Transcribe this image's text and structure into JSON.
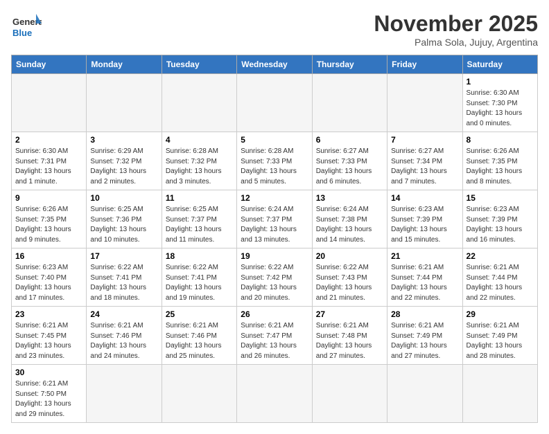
{
  "header": {
    "logo_general": "General",
    "logo_blue": "Blue",
    "month_title": "November 2025",
    "subtitle": "Palma Sola, Jujuy, Argentina"
  },
  "days_of_week": [
    "Sunday",
    "Monday",
    "Tuesday",
    "Wednesday",
    "Thursday",
    "Friday",
    "Saturday"
  ],
  "weeks": [
    [
      {
        "day": "",
        "empty": true
      },
      {
        "day": "",
        "empty": true
      },
      {
        "day": "",
        "empty": true
      },
      {
        "day": "",
        "empty": true
      },
      {
        "day": "",
        "empty": true
      },
      {
        "day": "",
        "empty": true
      },
      {
        "day": "1",
        "sunrise": "6:30 AM",
        "sunset": "7:30 PM",
        "daylight": "13 hours and 0 minutes."
      }
    ],
    [
      {
        "day": "2",
        "sunrise": "6:30 AM",
        "sunset": "7:31 PM",
        "daylight": "13 hours and 1 minute."
      },
      {
        "day": "3",
        "sunrise": "6:29 AM",
        "sunset": "7:32 PM",
        "daylight": "13 hours and 2 minutes."
      },
      {
        "day": "4",
        "sunrise": "6:28 AM",
        "sunset": "7:32 PM",
        "daylight": "13 hours and 3 minutes."
      },
      {
        "day": "5",
        "sunrise": "6:28 AM",
        "sunset": "7:33 PM",
        "daylight": "13 hours and 5 minutes."
      },
      {
        "day": "6",
        "sunrise": "6:27 AM",
        "sunset": "7:33 PM",
        "daylight": "13 hours and 6 minutes."
      },
      {
        "day": "7",
        "sunrise": "6:27 AM",
        "sunset": "7:34 PM",
        "daylight": "13 hours and 7 minutes."
      },
      {
        "day": "8",
        "sunrise": "6:26 AM",
        "sunset": "7:35 PM",
        "daylight": "13 hours and 8 minutes."
      }
    ],
    [
      {
        "day": "9",
        "sunrise": "6:26 AM",
        "sunset": "7:35 PM",
        "daylight": "13 hours and 9 minutes."
      },
      {
        "day": "10",
        "sunrise": "6:25 AM",
        "sunset": "7:36 PM",
        "daylight": "13 hours and 10 minutes."
      },
      {
        "day": "11",
        "sunrise": "6:25 AM",
        "sunset": "7:37 PM",
        "daylight": "13 hours and 11 minutes."
      },
      {
        "day": "12",
        "sunrise": "6:24 AM",
        "sunset": "7:37 PM",
        "daylight": "13 hours and 13 minutes."
      },
      {
        "day": "13",
        "sunrise": "6:24 AM",
        "sunset": "7:38 PM",
        "daylight": "13 hours and 14 minutes."
      },
      {
        "day": "14",
        "sunrise": "6:23 AM",
        "sunset": "7:39 PM",
        "daylight": "13 hours and 15 minutes."
      },
      {
        "day": "15",
        "sunrise": "6:23 AM",
        "sunset": "7:39 PM",
        "daylight": "13 hours and 16 minutes."
      }
    ],
    [
      {
        "day": "16",
        "sunrise": "6:23 AM",
        "sunset": "7:40 PM",
        "daylight": "13 hours and 17 minutes."
      },
      {
        "day": "17",
        "sunrise": "6:22 AM",
        "sunset": "7:41 PM",
        "daylight": "13 hours and 18 minutes."
      },
      {
        "day": "18",
        "sunrise": "6:22 AM",
        "sunset": "7:41 PM",
        "daylight": "13 hours and 19 minutes."
      },
      {
        "day": "19",
        "sunrise": "6:22 AM",
        "sunset": "7:42 PM",
        "daylight": "13 hours and 20 minutes."
      },
      {
        "day": "20",
        "sunrise": "6:22 AM",
        "sunset": "7:43 PM",
        "daylight": "13 hours and 21 minutes."
      },
      {
        "day": "21",
        "sunrise": "6:21 AM",
        "sunset": "7:44 PM",
        "daylight": "13 hours and 22 minutes."
      },
      {
        "day": "22",
        "sunrise": "6:21 AM",
        "sunset": "7:44 PM",
        "daylight": "13 hours and 22 minutes."
      }
    ],
    [
      {
        "day": "23",
        "sunrise": "6:21 AM",
        "sunset": "7:45 PM",
        "daylight": "13 hours and 23 minutes."
      },
      {
        "day": "24",
        "sunrise": "6:21 AM",
        "sunset": "7:46 PM",
        "daylight": "13 hours and 24 minutes."
      },
      {
        "day": "25",
        "sunrise": "6:21 AM",
        "sunset": "7:46 PM",
        "daylight": "13 hours and 25 minutes."
      },
      {
        "day": "26",
        "sunrise": "6:21 AM",
        "sunset": "7:47 PM",
        "daylight": "13 hours and 26 minutes."
      },
      {
        "day": "27",
        "sunrise": "6:21 AM",
        "sunset": "7:48 PM",
        "daylight": "13 hours and 27 minutes."
      },
      {
        "day": "28",
        "sunrise": "6:21 AM",
        "sunset": "7:49 PM",
        "daylight": "13 hours and 27 minutes."
      },
      {
        "day": "29",
        "sunrise": "6:21 AM",
        "sunset": "7:49 PM",
        "daylight": "13 hours and 28 minutes."
      }
    ],
    [
      {
        "day": "30",
        "sunrise": "6:21 AM",
        "sunset": "7:50 PM",
        "daylight": "13 hours and 29 minutes."
      },
      {
        "day": "",
        "empty": true
      },
      {
        "day": "",
        "empty": true
      },
      {
        "day": "",
        "empty": true
      },
      {
        "day": "",
        "empty": true
      },
      {
        "day": "",
        "empty": true
      },
      {
        "day": "",
        "empty": true
      }
    ]
  ],
  "labels": {
    "sunrise": "Sunrise:",
    "sunset": "Sunset:",
    "daylight": "Daylight:"
  }
}
